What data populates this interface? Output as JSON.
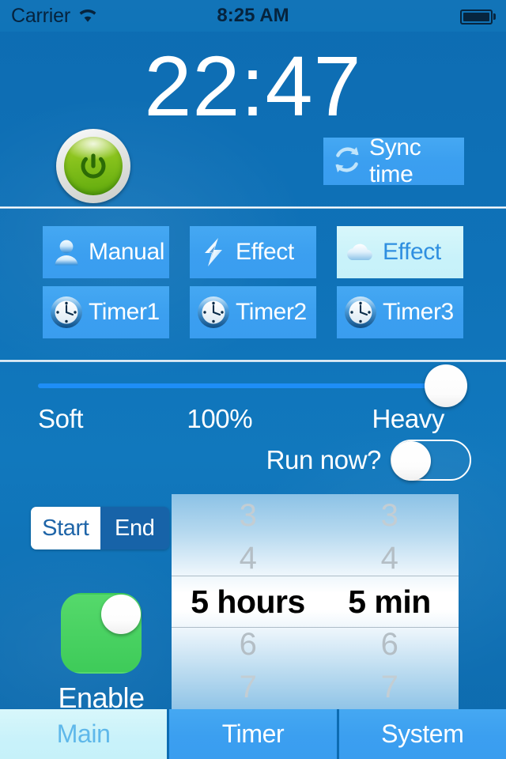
{
  "statusbar": {
    "carrier": "Carrier",
    "time": "8:25 AM",
    "wifi_icon": "wifi-icon",
    "battery_icon": "battery-icon"
  },
  "header": {
    "clock": "22:47",
    "power_button": {
      "icon": "power-icon",
      "state": "on",
      "color": "#86c11c"
    },
    "sync": {
      "label": "Sync time",
      "icon": "sync-refresh-icon",
      "bg": "#3b9ff0"
    }
  },
  "modes": {
    "rows": [
      [
        {
          "label": "Manual",
          "icon": "person-icon",
          "selected": false
        },
        {
          "label": "Effect",
          "icon": "lightning-bolt-icon",
          "selected": false
        },
        {
          "label": "Effect",
          "icon": "cloud-icon",
          "selected": true
        }
      ],
      [
        {
          "label": "Timer1",
          "icon": "clock-icon",
          "selected": false
        },
        {
          "label": "Timer2",
          "icon": "clock-icon",
          "selected": false
        },
        {
          "label": "Timer3",
          "icon": "clock-icon",
          "selected": false
        }
      ]
    ]
  },
  "intensity": {
    "min_label": "Soft",
    "value_label": "100%",
    "max_label": "Heavy",
    "value": 100,
    "min": 0,
    "max": 100,
    "track_color": "#1e8ef7"
  },
  "run_now": {
    "label": "Run now?",
    "state": "off",
    "state_text": "off"
  },
  "schedule": {
    "segments": [
      {
        "label": "Start",
        "selected": false
      },
      {
        "label": "End",
        "selected": true
      }
    ],
    "enable": {
      "label": "Enable",
      "state": "on",
      "state_text": "on",
      "on_color": "#3ecb59"
    },
    "picker": {
      "hours": {
        "above2": "3",
        "above1": "4",
        "current_value": "5",
        "current_unit": "hours",
        "below1": "6",
        "below2": "7"
      },
      "minutes": {
        "above2": "3",
        "above1": "4",
        "current_value": "5",
        "current_unit": "min",
        "below1": "6",
        "below2": "7"
      }
    }
  },
  "tabbar": {
    "tabs": [
      {
        "label": "Main",
        "active": true
      },
      {
        "label": "Timer",
        "active": false
      },
      {
        "label": "System",
        "active": false
      }
    ]
  }
}
